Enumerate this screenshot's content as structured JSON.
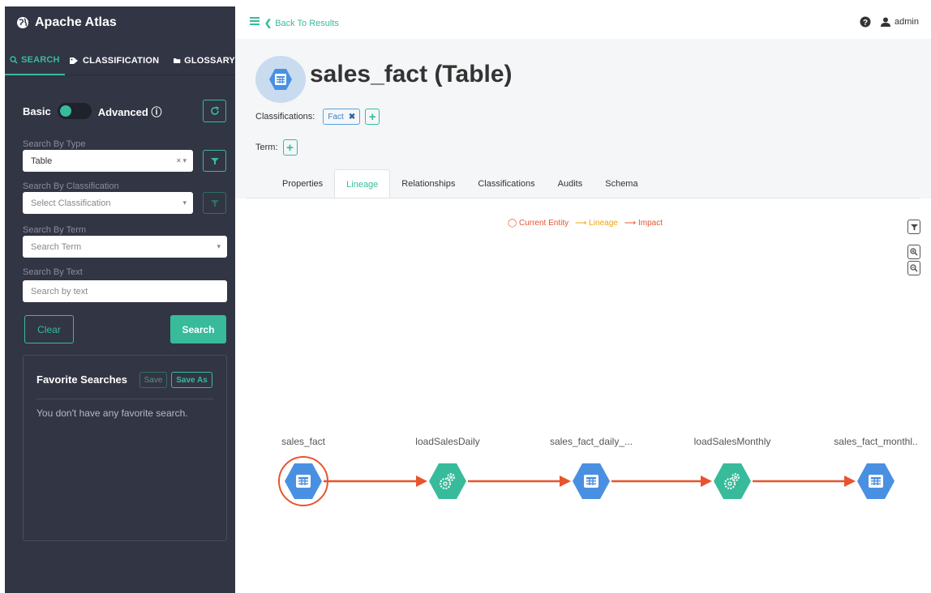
{
  "app": {
    "title": "Apache Atlas"
  },
  "sidebar": {
    "tabs": [
      {
        "label": "SEARCH",
        "icon": "search-icon",
        "active": true
      },
      {
        "label": "CLASSIFICATION",
        "icon": "tag-icon",
        "active": false
      },
      {
        "label": "GLOSSARY",
        "icon": "folder-icon",
        "active": false
      }
    ],
    "toggle": {
      "basic_label": "Basic",
      "advanced_label": "Advanced ⓘ",
      "selected": "Basic"
    },
    "search_by_type": {
      "label": "Search By Type",
      "value": "Table",
      "clear": "×"
    },
    "search_by_classification": {
      "label": "Search By Classification",
      "placeholder": "Select Classification"
    },
    "search_by_term": {
      "label": "Search By Term",
      "placeholder": "Search Term"
    },
    "search_by_text": {
      "label": "Search By Text",
      "placeholder": "Search by text"
    },
    "clear_label": "Clear",
    "search_label": "Search",
    "favorites": {
      "title": "Favorite Searches",
      "save_label": "Save",
      "save_as_label": "Save As",
      "empty_text": "You don't have any favorite search."
    }
  },
  "topbar": {
    "back_label": "Back To Results",
    "user": "admin"
  },
  "entity": {
    "title": "sales_fact (Table)",
    "classifications_label": "Classifications:",
    "classifications": [
      "Fact"
    ],
    "term_label": "Term:"
  },
  "tabs": [
    "Properties",
    "Lineage",
    "Relationships",
    "Classifications",
    "Audits",
    "Schema"
  ],
  "active_tab": "Lineage",
  "legend": {
    "current": "Current Entity",
    "lineage": "Lineage",
    "impact": "Impact"
  },
  "lineage": {
    "nodes": [
      {
        "label": "sales_fact",
        "kind": "table",
        "current": true
      },
      {
        "label": "loadSalesDaily",
        "kind": "process",
        "current": false
      },
      {
        "label": "sales_fact_daily_...",
        "kind": "table",
        "current": false
      },
      {
        "label": "loadSalesMonthly",
        "kind": "process",
        "current": false
      },
      {
        "label": "sales_fact_monthl..",
        "kind": "table",
        "current": false
      }
    ]
  },
  "colors": {
    "accent": "#38bb9b",
    "sidebar": "#323544",
    "table_node": "#4a90e2",
    "process_node": "#38bb9b",
    "impact": "#e8542c",
    "lineage": "#f0a30a"
  }
}
